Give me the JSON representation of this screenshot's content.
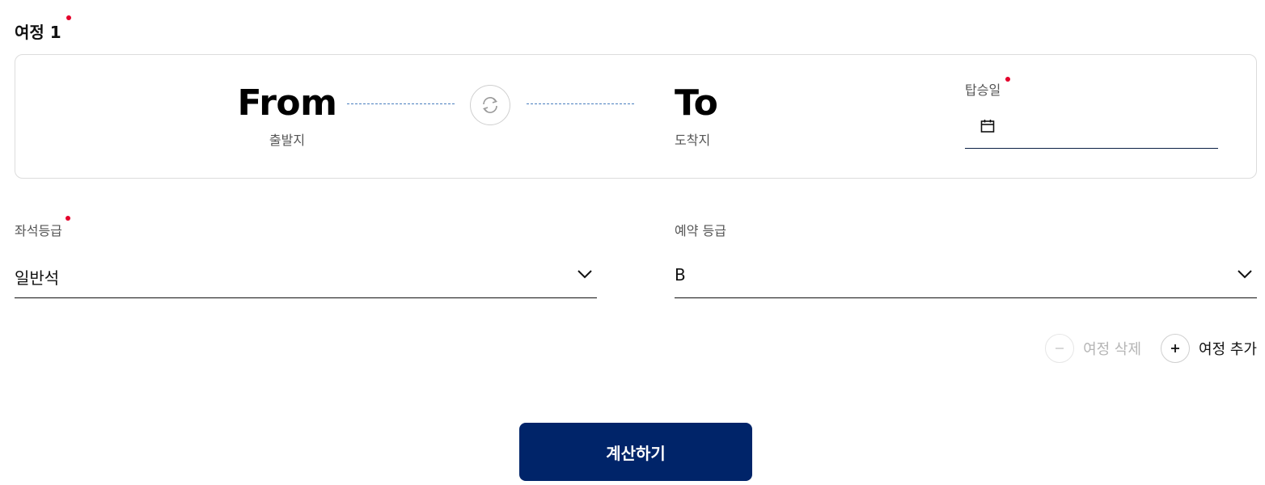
{
  "segment": {
    "title": "여정 1",
    "from": {
      "code": "From",
      "label": "출발지"
    },
    "to": {
      "code": "To",
      "label": "도착지"
    },
    "swap_icon": "swap-arrows-icon",
    "departure_date": {
      "label": "탑승일",
      "value": "",
      "icon": "calendar-icon"
    }
  },
  "seat_class": {
    "label": "좌석등급",
    "value": "일반석",
    "icon": "chevron-down-icon"
  },
  "booking_class": {
    "label": "예약 등급",
    "value": "B",
    "icon": "chevron-down-icon"
  },
  "actions": {
    "remove": {
      "label": "여정 삭제",
      "icon": "minus-icon",
      "state": "disabled"
    },
    "add": {
      "label": "여정 추가",
      "icon": "plus-icon",
      "state": "enabled"
    }
  },
  "calculate_button": {
    "label": "계산하기"
  },
  "colors": {
    "primary": "#002469",
    "required_dot": "#e4002b",
    "route_dash": "#4a7fbf",
    "disabled_text": "#b5b5b5"
  }
}
